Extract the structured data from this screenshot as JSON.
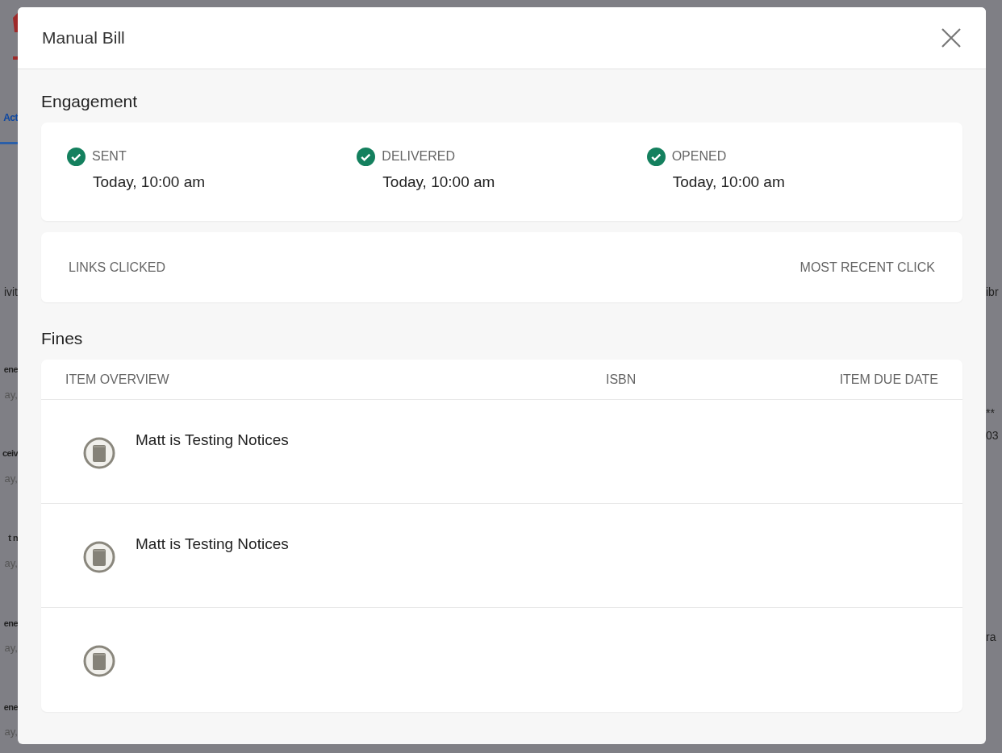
{
  "background": {
    "left": [
      {
        "text": "Act",
        "kind": "tab"
      },
      {
        "text": "ivit",
        "kind": "plain"
      },
      {
        "text": "ene",
        "kind": "bold"
      },
      {
        "text": "ay,",
        "kind": "muted"
      },
      {
        "text": "ceiv",
        "kind": "bold"
      },
      {
        "text": "ay,",
        "kind": "muted"
      },
      {
        "text": "t n",
        "kind": "bold"
      },
      {
        "text": "ay,",
        "kind": "muted"
      },
      {
        "text": "ene",
        "kind": "bold"
      },
      {
        "text": "ay,",
        "kind": "muted"
      },
      {
        "text": "ene",
        "kind": "bold"
      },
      {
        "text": "ay,",
        "kind": "muted"
      }
    ],
    "right": [
      {
        "text": "ibr"
      },
      {
        "text": "**"
      },
      {
        "text": "03"
      },
      {
        "text": "ra"
      }
    ]
  },
  "modal": {
    "title": "Manual Bill",
    "engagement": {
      "heading": "Engagement",
      "statuses": [
        {
          "label": "SENT",
          "time": "Today, 10:00 am",
          "done": true
        },
        {
          "label": "DELIVERED",
          "time": "Today, 10:00 am",
          "done": true
        },
        {
          "label": "OPENED",
          "time": "Today, 10:00 am",
          "done": true
        }
      ],
      "links_clicked": "LINKS CLICKED",
      "most_recent_click": "MOST RECENT CLICK"
    },
    "fines": {
      "heading": "Fines",
      "columns": [
        "ITEM OVERVIEW",
        "ISBN",
        "ITEM DUE DATE"
      ],
      "rows": [
        {
          "title": "Matt is Testing Notices"
        },
        {
          "title": "Matt is Testing Notices"
        },
        {}
      ]
    }
  }
}
